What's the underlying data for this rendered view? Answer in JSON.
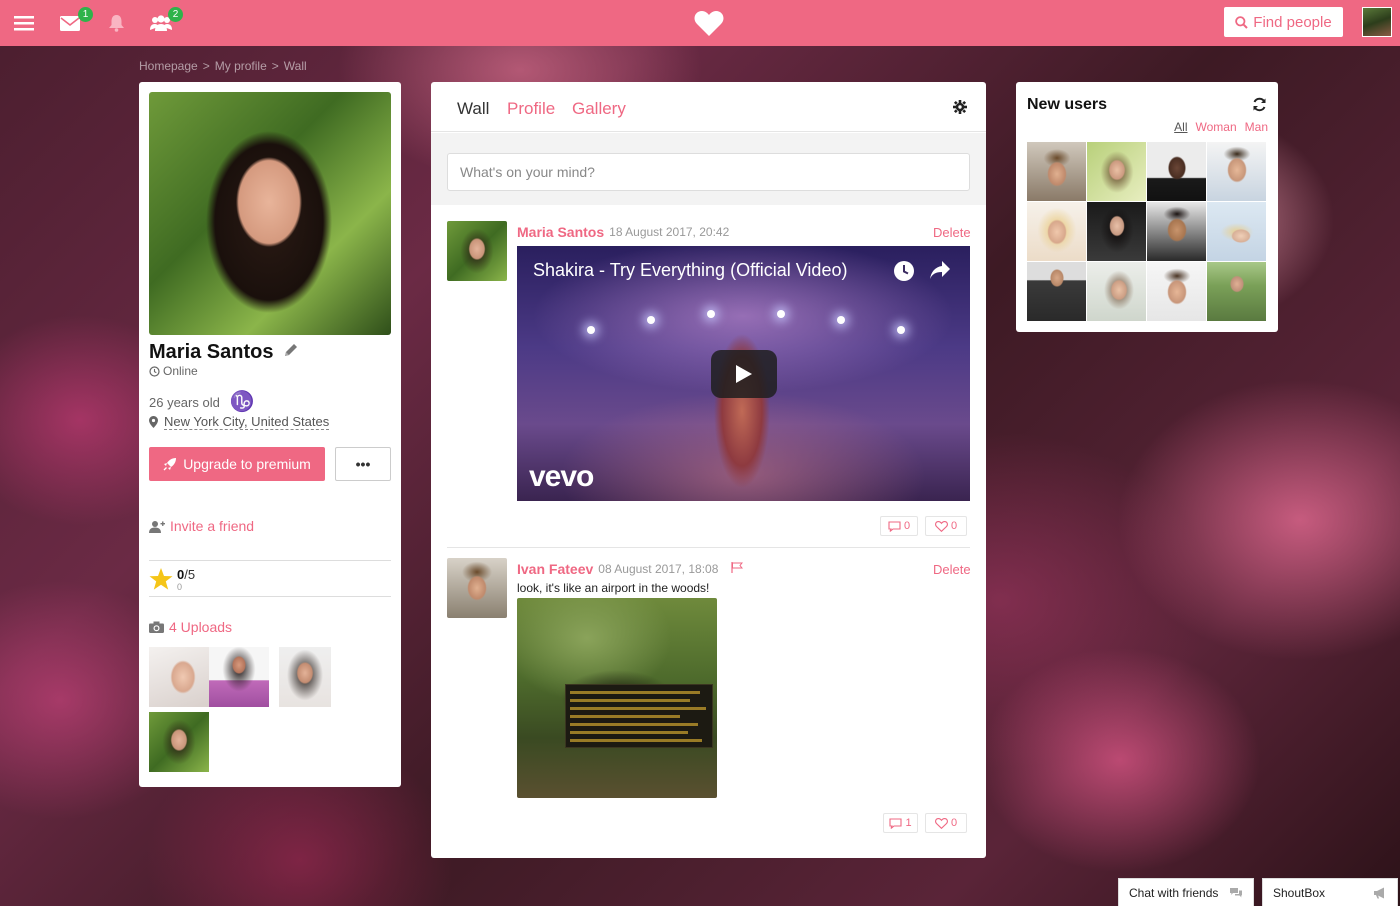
{
  "header": {
    "menu_icon": "hamburger-icon",
    "messages_icon": "envelope-icon",
    "messages_badge": "1",
    "notifications_icon": "bell-icon",
    "friends_icon": "users-icon",
    "friends_badge": "2",
    "logo_icon": "heart-icon",
    "find_people_label": "Find people",
    "accent_color": "#ef6883"
  },
  "breadcrumb": [
    "Homepage",
    "My profile",
    "Wall"
  ],
  "profile": {
    "name": "Maria Santos",
    "status": "Online",
    "age": "26 years old",
    "zodiac": "♑",
    "location": "New York City, United States",
    "upgrade_label": "Upgrade to premium",
    "more_label": "•••",
    "invite_label": "Invite a friend",
    "rating_value": "0",
    "rating_max": "/5",
    "rating_count": "0",
    "uploads_label": "4 Uploads"
  },
  "wall": {
    "tabs": [
      "Wall",
      "Profile",
      "Gallery"
    ],
    "composer_placeholder": "What's on your mind?",
    "posts": [
      {
        "author": "Maria Santos",
        "date": "18 August 2017, 20:42",
        "delete_label": "Delete",
        "video_title": "Shakira - Try Everything (Official Video)",
        "video_brand": "vevo",
        "comments": "0",
        "likes": "0"
      },
      {
        "author": "Ivan Fateev",
        "date": "08 August 2017, 18:08",
        "delete_label": "Delete",
        "text": "look, it's like an airport in the woods!",
        "comments": "1",
        "likes": "0"
      }
    ]
  },
  "new_users": {
    "title": "New users",
    "filters": [
      "All",
      "Woman",
      "Man"
    ]
  },
  "chat": {
    "friends_label": "Chat with friends",
    "shoutbox_label": "ShoutBox"
  }
}
